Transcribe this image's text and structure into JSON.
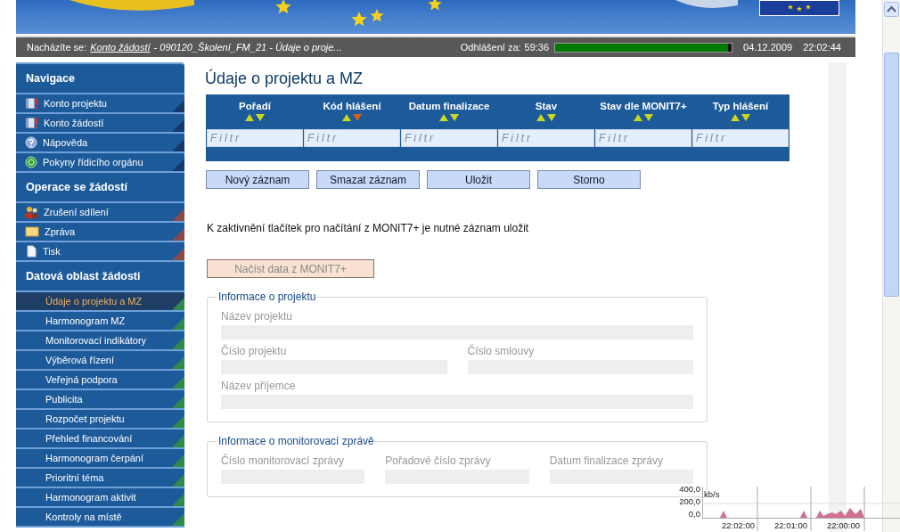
{
  "breadcrumb": {
    "prefix": "Nacházíte se:",
    "link": "Konto žádostí",
    "rest": "- 090120_Školení_FM_21 - Údaje o proje..."
  },
  "session": {
    "label": "Odhlášení za:",
    "time": "59:36",
    "level": 0.98,
    "date": "04.12.2009",
    "clock": "22:02:44"
  },
  "sidebar": {
    "sections": [
      {
        "title": "Navigace",
        "color": "#16386b",
        "items": [
          {
            "label": "Konto projektu",
            "selected": false
          },
          {
            "label": "Konto žádostí",
            "selected": false
          },
          {
            "label": "Nápověda",
            "selected": false
          },
          {
            "label": "Pokyny řídicího orgánu",
            "selected": false
          }
        ]
      },
      {
        "title": "Operace se žádostí",
        "color": "#8a4a4a",
        "items": [
          {
            "label": "Zrušení sdílení",
            "selected": false
          },
          {
            "label": "Zpráva",
            "selected": false
          },
          {
            "label": "Tisk",
            "selected": false
          }
        ]
      },
      {
        "title": "Datová oblast žádosti",
        "color": "#2f8a4a",
        "items": [
          {
            "label": "Údaje o projektu a MZ",
            "selected": true
          },
          {
            "label": "Harmonogram MZ",
            "selected": false
          },
          {
            "label": "Monitorovací indikátory",
            "selected": false
          },
          {
            "label": "Výběrová řízení",
            "selected": false
          },
          {
            "label": "Veřejná podpora",
            "selected": false
          },
          {
            "label": "Publicita",
            "selected": false
          },
          {
            "label": "Rozpočet projektu",
            "selected": false
          },
          {
            "label": "Přehled financování",
            "selected": false
          },
          {
            "label": "Harmonogram čerpání",
            "selected": false
          },
          {
            "label": "Prioritní téma",
            "selected": false
          },
          {
            "label": "Harmonogram aktivit",
            "selected": false
          },
          {
            "label": "Kontroly na místě",
            "selected": false
          }
        ]
      }
    ]
  },
  "page_title": "Údaje o projektu a MZ",
  "table": {
    "columns": [
      {
        "label": "Pořadí",
        "sorted": false,
        "placeholder": "Filtr"
      },
      {
        "label": "Kód hlášení",
        "sorted": true,
        "placeholder": "Filtr"
      },
      {
        "label": "Datum finalizace",
        "sorted": false,
        "placeholder": "Filtr"
      },
      {
        "label": "Stav",
        "sorted": false,
        "placeholder": "Filtr"
      },
      {
        "label": "Stav dle MONIT7+",
        "sorted": false,
        "placeholder": "Filtr"
      },
      {
        "label": "Typ hlášení",
        "sorted": false,
        "placeholder": "Filtr"
      }
    ]
  },
  "buttons": [
    {
      "label": "Nový záznam"
    },
    {
      "label": "Smazat záznam"
    },
    {
      "label": "Uložit"
    },
    {
      "label": "Storno"
    }
  ],
  "note": "K zaktivnění tlačítek pro načítání z MONIT7+ je nutné záznam uložit",
  "load_button": {
    "label": "Načíst data z MONIT7+",
    "disabled": true
  },
  "fieldsets": [
    {
      "legend": "Informace o projektu",
      "rows": [
        [
          {
            "label": "Název projektu",
            "disabled": true
          }
        ],
        [
          {
            "label": "Číslo projektu",
            "disabled": true
          },
          {
            "label": "Číslo smlouvy",
            "disabled": true
          }
        ],
        [
          {
            "label": "Název příjemce",
            "disabled": true
          }
        ]
      ]
    },
    {
      "legend": "Informace o monitorovací zprávě",
      "rows": [
        [
          {
            "label": "Číslo monitorovací zprávy",
            "disabled": true
          },
          {
            "label": "Pořadové číslo zprávy",
            "disabled": true
          },
          {
            "label": "Datum finalizace zprávy",
            "disabled": true
          }
        ]
      ]
    }
  ],
  "network_monitor": {
    "unit": "kb/s",
    "y_ticks": [
      "400,0",
      "200,0",
      "0,0"
    ],
    "x_labels": [
      "22:02:00",
      "22:01:00",
      "22:00:00"
    ]
  }
}
